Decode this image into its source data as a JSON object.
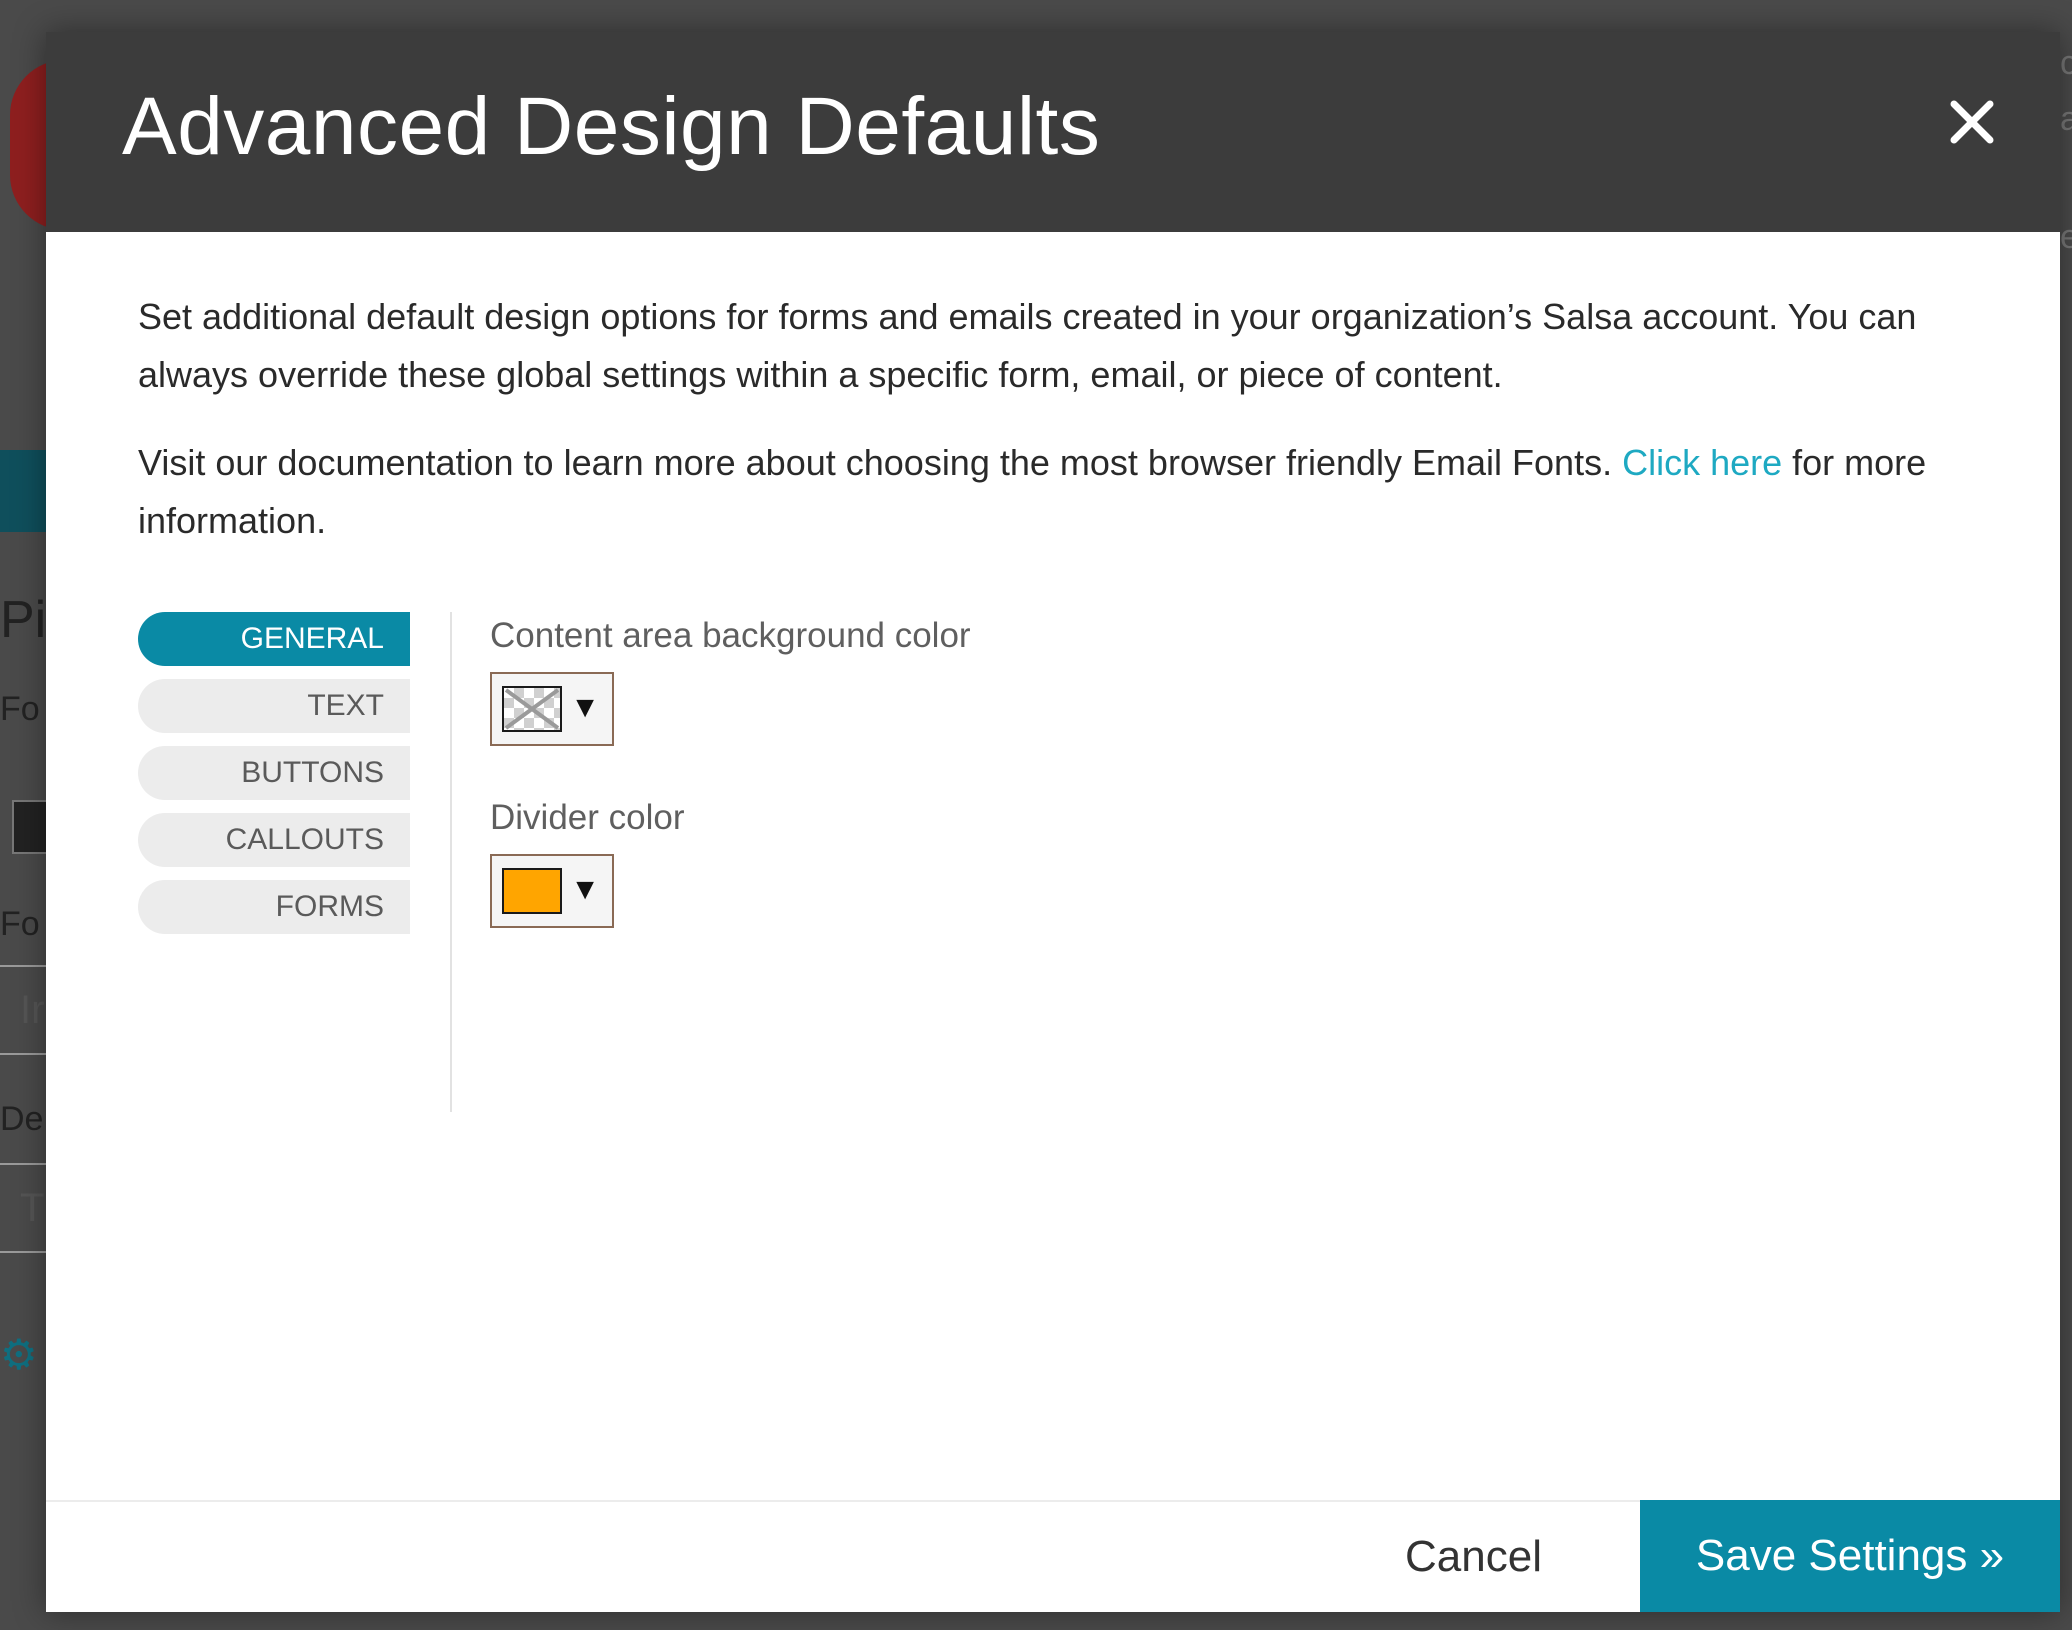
{
  "modal": {
    "title": "Advanced Design Defaults",
    "intro_paragraph": "Set additional default design options for forms and emails created in your organization’s Salsa account. You can always override these global settings within a specific form, email, or piece of content.",
    "docs_text_before": "Visit our documentation to learn more about choosing the most browser friendly Email Fonts. ",
    "docs_link": "Click here",
    "docs_text_after": " for more information."
  },
  "tabs": [
    {
      "label": "GENERAL",
      "active": true
    },
    {
      "label": "TEXT",
      "active": false
    },
    {
      "label": "BUTTONS",
      "active": false
    },
    {
      "label": "CALLOUTS",
      "active": false
    },
    {
      "label": "FORMS",
      "active": false
    }
  ],
  "settings": {
    "content_bg": {
      "label": "Content area background color",
      "value": "transparent",
      "dropdown_arrow": "▼"
    },
    "divider": {
      "label": "Divider color",
      "value": "#FFA500",
      "dropdown_arrow": "▼"
    }
  },
  "footer": {
    "cancel_label": "Cancel",
    "save_label": "Save Settings »"
  },
  "background": {
    "heading_fragment": "Pi",
    "label_1": "Fo",
    "label_2": "Fo",
    "input_1": "Ir",
    "label_3": "De",
    "input_2": "T",
    "right_chars": [
      "c",
      "a",
      "e"
    ]
  },
  "colors": {
    "header_bg": "#3c3c3c",
    "accent": "#0a8aa5",
    "link": "#1ea9c2",
    "overlay": "#4a4a4a"
  }
}
